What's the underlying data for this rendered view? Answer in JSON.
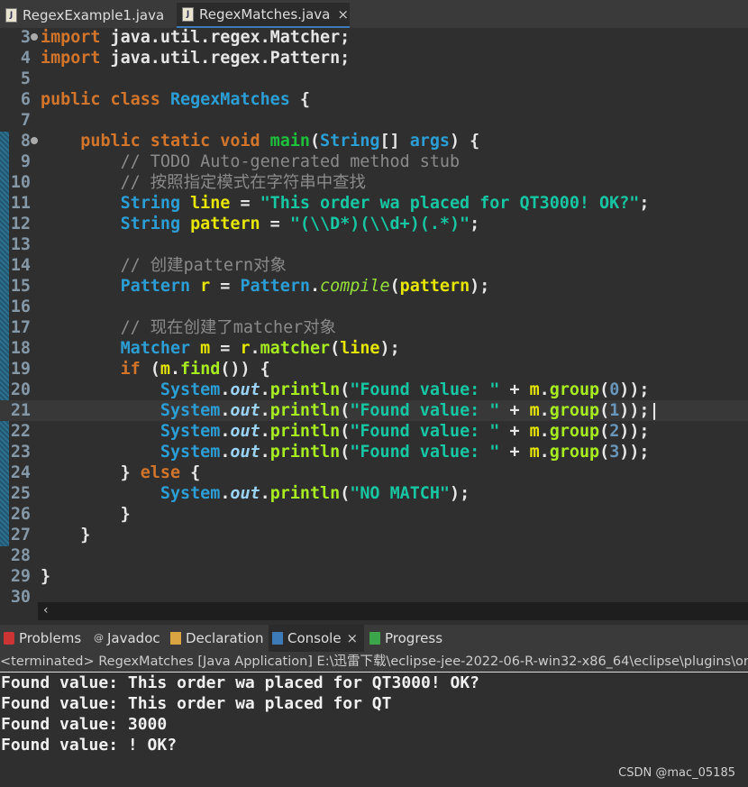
{
  "editor_tabs": [
    {
      "label": "RegexExample1.java",
      "icon": "java-file-icon"
    },
    {
      "label": "RegexMatches.java",
      "icon": "java-file-icon",
      "active": true,
      "close": "×"
    }
  ],
  "code_lines": [
    {
      "n": "3",
      "fold": true,
      "t": [
        [
          "kw",
          "import"
        ],
        [
          "pl",
          " java.util.regex.Matcher;"
        ]
      ]
    },
    {
      "n": "4",
      "t": [
        [
          "kw",
          "import"
        ],
        [
          "pl",
          " java.util.regex.Pattern;"
        ]
      ]
    },
    {
      "n": "5",
      "t": []
    },
    {
      "n": "6",
      "t": [
        [
          "kw",
          "public class "
        ],
        [
          "cls",
          "RegexMatches"
        ],
        [
          "pl",
          " {"
        ]
      ]
    },
    {
      "n": "7",
      "t": []
    },
    {
      "n": "8",
      "fold": true,
      "t": [
        [
          "pl",
          "    "
        ],
        [
          "kw",
          "public static void "
        ],
        [
          "method",
          "main"
        ],
        [
          "pl",
          "("
        ],
        [
          "cls",
          "String"
        ],
        [
          "pl",
          "[] "
        ],
        [
          "cls",
          "args"
        ],
        [
          "pl",
          ") {"
        ]
      ]
    },
    {
      "n": "9",
      "t": [
        [
          "pl",
          "        "
        ],
        [
          "com",
          "// TODO Auto-generated method stub"
        ]
      ]
    },
    {
      "n": "10",
      "t": [
        [
          "pl",
          "        "
        ],
        [
          "com",
          "// 按照指定模式在字符串中查找"
        ]
      ]
    },
    {
      "n": "11",
      "t": [
        [
          "pl",
          "        "
        ],
        [
          "cls",
          "String "
        ],
        [
          "var",
          "line"
        ],
        [
          "pl",
          " = "
        ],
        [
          "str",
          "\"This order wa placed for QT3000! OK?\""
        ],
        [
          "pl",
          ";"
        ]
      ]
    },
    {
      "n": "12",
      "t": [
        [
          "pl",
          "        "
        ],
        [
          "cls",
          "String "
        ],
        [
          "var",
          "pattern"
        ],
        [
          "pl",
          " = "
        ],
        [
          "str",
          "\"(\\\\D*)(\\\\d+)(.*)\""
        ],
        [
          "pl",
          ";"
        ]
      ]
    },
    {
      "n": "13",
      "t": []
    },
    {
      "n": "14",
      "t": [
        [
          "pl",
          "        "
        ],
        [
          "com",
          "// 创建pattern对象"
        ]
      ]
    },
    {
      "n": "15",
      "t": [
        [
          "pl",
          "        "
        ],
        [
          "cls",
          "Pattern "
        ],
        [
          "var",
          "r"
        ],
        [
          "pl",
          " = "
        ],
        [
          "cls",
          "Pattern"
        ],
        [
          "pl",
          "."
        ],
        [
          "smeth",
          "compile"
        ],
        [
          "pl",
          "("
        ],
        [
          "var",
          "pattern"
        ],
        [
          "pl",
          ");"
        ]
      ]
    },
    {
      "n": "16",
      "t": []
    },
    {
      "n": "17",
      "t": [
        [
          "pl",
          "        "
        ],
        [
          "com",
          "// 现在创建了matcher对象"
        ]
      ]
    },
    {
      "n": "18",
      "t": [
        [
          "pl",
          "        "
        ],
        [
          "cls",
          "Matcher "
        ],
        [
          "var",
          "m"
        ],
        [
          "pl",
          " = "
        ],
        [
          "var",
          "r"
        ],
        [
          "pl",
          "."
        ],
        [
          "mcall",
          "matcher"
        ],
        [
          "pl",
          "("
        ],
        [
          "var",
          "line"
        ],
        [
          "pl",
          ");"
        ]
      ]
    },
    {
      "n": "19",
      "t": [
        [
          "pl",
          "        "
        ],
        [
          "kw",
          "if"
        ],
        [
          "pl",
          " ("
        ],
        [
          "var",
          "m"
        ],
        [
          "pl",
          "."
        ],
        [
          "mcall",
          "find"
        ],
        [
          "pl",
          "()) {"
        ]
      ]
    },
    {
      "n": "20",
      "t": [
        [
          "pl",
          "            "
        ],
        [
          "cls",
          "System"
        ],
        [
          "pl",
          "."
        ],
        [
          "fld",
          "out"
        ],
        [
          "pl",
          "."
        ],
        [
          "mcall",
          "println"
        ],
        [
          "pl",
          "("
        ],
        [
          "str",
          "\"Found value: \""
        ],
        [
          "pl",
          " + "
        ],
        [
          "var",
          "m"
        ],
        [
          "pl",
          "."
        ],
        [
          "mcall",
          "group"
        ],
        [
          "pl",
          "("
        ],
        [
          "num",
          "0"
        ],
        [
          "pl",
          "));"
        ]
      ]
    },
    {
      "n": "21",
      "cur": true,
      "t": [
        [
          "pl",
          "            "
        ],
        [
          "cls",
          "System"
        ],
        [
          "pl",
          "."
        ],
        [
          "fld",
          "out"
        ],
        [
          "pl",
          "."
        ],
        [
          "mcall",
          "println"
        ],
        [
          "pl",
          "("
        ],
        [
          "str",
          "\"Found value: \""
        ],
        [
          "pl",
          " + "
        ],
        [
          "var",
          "m"
        ],
        [
          "pl",
          "."
        ],
        [
          "mcall",
          "group"
        ],
        [
          "pl",
          "("
        ],
        [
          "num",
          "1"
        ],
        [
          "pl",
          "));|"
        ]
      ]
    },
    {
      "n": "22",
      "t": [
        [
          "pl",
          "            "
        ],
        [
          "cls",
          "System"
        ],
        [
          "pl",
          "."
        ],
        [
          "fld",
          "out"
        ],
        [
          "pl",
          "."
        ],
        [
          "mcall",
          "println"
        ],
        [
          "pl",
          "("
        ],
        [
          "str",
          "\"Found value: \""
        ],
        [
          "pl",
          " + "
        ],
        [
          "var",
          "m"
        ],
        [
          "pl",
          "."
        ],
        [
          "mcall",
          "group"
        ],
        [
          "pl",
          "("
        ],
        [
          "num",
          "2"
        ],
        [
          "pl",
          "));"
        ]
      ]
    },
    {
      "n": "23",
      "t": [
        [
          "pl",
          "            "
        ],
        [
          "cls",
          "System"
        ],
        [
          "pl",
          "."
        ],
        [
          "fld",
          "out"
        ],
        [
          "pl",
          "."
        ],
        [
          "mcall",
          "println"
        ],
        [
          "pl",
          "("
        ],
        [
          "str",
          "\"Found value: \""
        ],
        [
          "pl",
          " + "
        ],
        [
          "var",
          "m"
        ],
        [
          "pl",
          "."
        ],
        [
          "mcall",
          "group"
        ],
        [
          "pl",
          "("
        ],
        [
          "num",
          "3"
        ],
        [
          "pl",
          "));"
        ]
      ]
    },
    {
      "n": "24",
      "t": [
        [
          "pl",
          "        } "
        ],
        [
          "kw",
          "else"
        ],
        [
          "pl",
          " {"
        ]
      ]
    },
    {
      "n": "25",
      "t": [
        [
          "pl",
          "            "
        ],
        [
          "cls",
          "System"
        ],
        [
          "pl",
          "."
        ],
        [
          "fld",
          "out"
        ],
        [
          "pl",
          "."
        ],
        [
          "mcall",
          "println"
        ],
        [
          "pl",
          "("
        ],
        [
          "str",
          "\"NO MATCH\""
        ],
        [
          "pl",
          ");"
        ]
      ]
    },
    {
      "n": "26",
      "t": [
        [
          "pl",
          "        }"
        ]
      ]
    },
    {
      "n": "27",
      "t": [
        [
          "pl",
          "    }"
        ]
      ]
    },
    {
      "n": "28",
      "t": []
    },
    {
      "n": "29",
      "t": [
        [
          "pl",
          "}"
        ]
      ]
    },
    {
      "n": "30",
      "t": []
    }
  ],
  "bottom_tabs": [
    {
      "label": "Problems",
      "icon": "problems-icon"
    },
    {
      "label": "Javadoc",
      "icon": "javadoc-icon"
    },
    {
      "label": "Declaration",
      "icon": "declaration-icon"
    },
    {
      "label": "Console",
      "icon": "console-icon",
      "active": true,
      "close": "×"
    },
    {
      "label": "Progress",
      "icon": "progress-icon"
    }
  ],
  "console_status": "<terminated> RegexMatches [Java Application] E:\\迅雷下载\\eclipse-jee-2022-06-R-win32-x86_64\\eclipse\\plugins\\org",
  "console_output": [
    "Found value: This order wa placed for QT3000! OK?",
    "Found value: This order wa placed for QT",
    "Found value: 3000",
    "Found value: ! OK?"
  ],
  "watermark": "CSDN @mac_05185",
  "scroll_left": "‹"
}
